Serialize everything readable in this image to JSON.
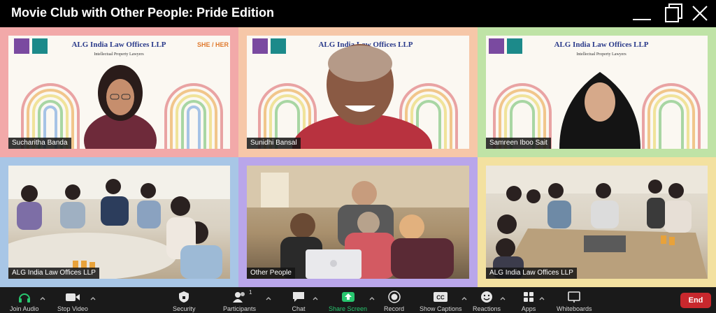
{
  "window": {
    "title": "Movie Club with Other People: Pride Edition"
  },
  "tiles": [
    {
      "label": "Sucharitha Banda",
      "banner": "ALG India Law Offices LLP",
      "sub": "Intellectual Property Lawyers",
      "logo": "alg",
      "corner": "SHE / HER",
      "border": "#f2a9a9"
    },
    {
      "label": "Sunidhi Bansal",
      "banner": "ALG India Law Offices LLP",
      "sub": "",
      "logo": "alg",
      "corner": "",
      "border": "#f6c7a8"
    },
    {
      "label": "Samreen Iboo Sait",
      "banner": "ALG India Law Offices LLP",
      "sub": "Intellectual Property Lawyers",
      "logo": "alg",
      "corner": "",
      "border": "#bfe3a6"
    },
    {
      "label": "ALG India Law Offices LLP",
      "border": "#a8c6e6"
    },
    {
      "label": "Other People",
      "border": "#b9a6ea"
    },
    {
      "label": "ALG India Law Offices LLP",
      "border": "#f3e1a0"
    }
  ],
  "toolbar": {
    "join_audio": "Join Audio",
    "stop_video": "Stop Video",
    "security": "Security",
    "participants": "Participants",
    "participants_count": "1",
    "chat": "Chat",
    "share_screen": "Share Screen",
    "record": "Record",
    "show_captions": "Show Captions",
    "captions_icon_text": "CC",
    "reactions": "Reactions",
    "apps": "Apps",
    "whiteboards": "Whiteboards",
    "end": "End"
  },
  "colors": {
    "share_green": "#28c76f",
    "end_red": "#c8282d"
  }
}
